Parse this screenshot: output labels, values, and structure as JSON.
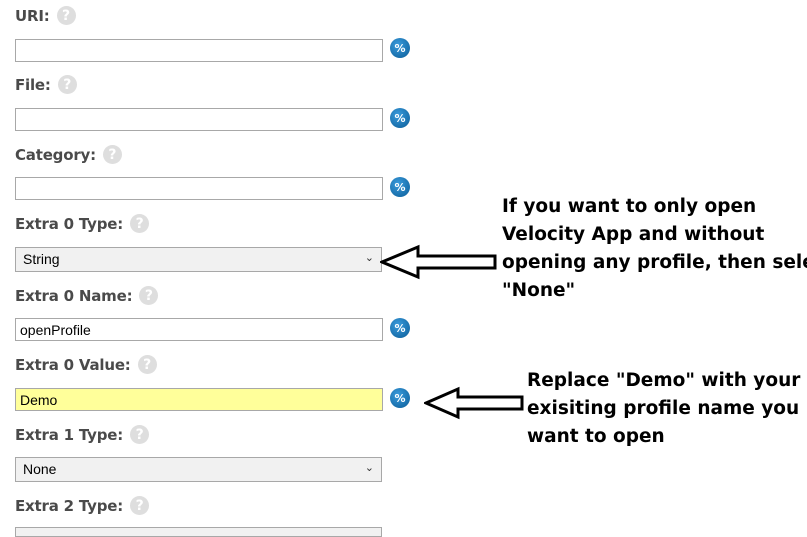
{
  "fields": {
    "uri": {
      "label": "URI:",
      "value": ""
    },
    "file": {
      "label": "File:",
      "value": ""
    },
    "category": {
      "label": "Category:",
      "value": ""
    },
    "extra0_type": {
      "label": "Extra 0 Type:",
      "selected": "String"
    },
    "extra0_name": {
      "label": "Extra 0 Name:",
      "value": "openProfile"
    },
    "extra0_value": {
      "label": "Extra 0 Value:",
      "value": "Demo",
      "highlight": "#ffff9a"
    },
    "extra1_type": {
      "label": "Extra 1 Type:",
      "selected": "None"
    },
    "extra2_type": {
      "label": "Extra 2 Type:"
    }
  },
  "icons": {
    "help": "?",
    "variable": "%",
    "chevron": "⌄"
  },
  "annotations": {
    "note_none": {
      "lines": [
        "If you want to only open",
        "Velocity App and without",
        "opening any profile, then select",
        "\"None\""
      ]
    },
    "note_demo": {
      "lines": [
        "Replace \"Demo\" with your",
        "exisiting profile name you",
        "want to open"
      ]
    }
  },
  "colors": {
    "accent_blue": "#0a5c97",
    "highlight": "#ffff9a"
  }
}
